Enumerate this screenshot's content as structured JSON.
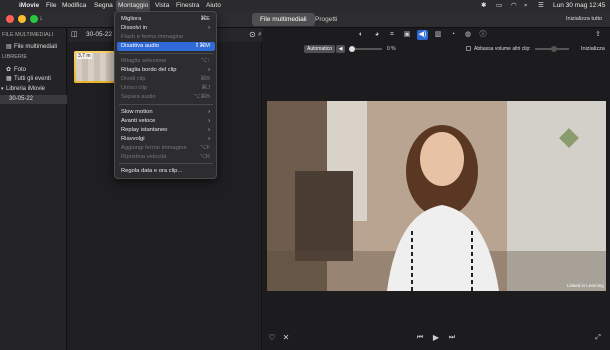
{
  "menubar": {
    "app": "iMovie",
    "items": [
      "File",
      "Modifica",
      "Segna",
      "Montaggio",
      "Vista",
      "Finestra",
      "Aiuto"
    ],
    "clock": "Lun 30 mag  12:45"
  },
  "toolbar": {
    "tabs": [
      "File multimediali",
      "Progetti"
    ],
    "reset_all": "Inizializza tutto"
  },
  "sidebar": {
    "header": "FILE MULTIMEDIALI",
    "media_item": "File multimediali",
    "libraries_header": "LIBRERIE",
    "photos": "Foto",
    "all_events": "Tutti gli eventi",
    "library": "Libreria iMovie",
    "event": "30-05-22"
  },
  "browser": {
    "event_title": "30-05-22",
    "clip_duration": "3,7 m"
  },
  "viewer": {
    "auto_button": "Automatico",
    "volume_percent": "0 %",
    "lower_others_label": "Abbassa volume altri clip:",
    "reset_label": "Inizializza",
    "watermark": "Linked in Learning"
  },
  "menu": {
    "items": [
      {
        "label": "Migliora",
        "shortcut": "⌘E",
        "state": "normal"
      },
      {
        "label": "Dissolvi in",
        "arrow": "›",
        "state": "normal"
      },
      {
        "label": "Flash e fermo immagine",
        "state": "disabled"
      },
      {
        "label": "Disattiva audio",
        "shortcut": "⇧⌘M",
        "state": "highlighted"
      },
      {
        "label": "Ritaglia selezione",
        "shortcut": "⌥↑",
        "state": "disabled"
      },
      {
        "label": "Ritaglia bordo del clip",
        "arrow": "›",
        "state": "normal"
      },
      {
        "label": "Dividi clip",
        "shortcut": "⌘B",
        "state": "disabled"
      },
      {
        "label": "Unisci clip",
        "shortcut": "⌘J",
        "state": "disabled"
      },
      {
        "label": "Separa audio",
        "shortcut": "⌥⌘B",
        "state": "disabled"
      },
      {
        "label": "Slow motion",
        "arrow": "›",
        "state": "normal"
      },
      {
        "label": "Avanti veloce",
        "arrow": "›",
        "state": "normal"
      },
      {
        "label": "Replay istantaneo",
        "arrow": "›",
        "state": "normal"
      },
      {
        "label": "Riavvolgi",
        "arrow": "›",
        "state": "normal"
      },
      {
        "label": "Aggiungi fermo immagine",
        "shortcut": "⌥F",
        "state": "disabled"
      },
      {
        "label": "Ripristina velocità",
        "shortcut": "⌥R",
        "state": "disabled"
      },
      {
        "label": "Regola data e ora clip...",
        "state": "normal"
      }
    ]
  },
  "colors": {
    "highlight": "#2f6ad8",
    "close": "#ff5f57",
    "minimize": "#febc2e",
    "zoom": "#28c840",
    "clip": "#f5c23a",
    "selected_row": "#3a3a3c"
  },
  "icons": [
    "apple-icon",
    "import-arrow-icon",
    "sidebar-toggle-icon",
    "zoom-search-icon",
    "color-balance-icon",
    "color-correction-icon",
    "crop-icon",
    "stabilization-icon",
    "volume-icon",
    "noise-reduction-icon",
    "speed-icon",
    "filter-icon",
    "info-icon",
    "share-icon",
    "favorite-heart-icon",
    "reject-icon",
    "previous-icon",
    "play-icon",
    "next-icon",
    "fullscreen-icon"
  ]
}
